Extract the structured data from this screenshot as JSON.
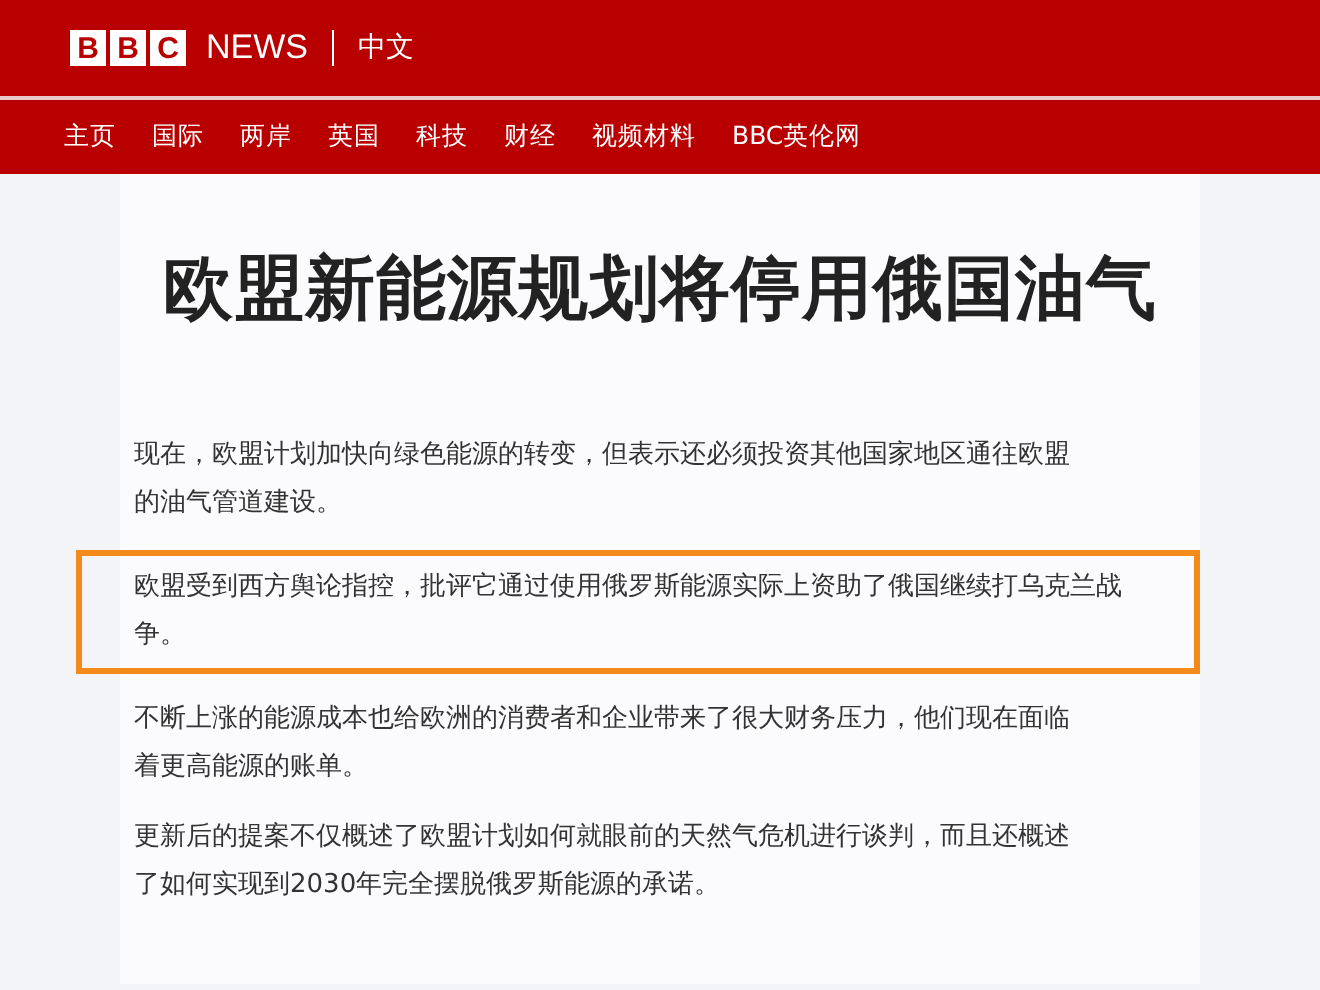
{
  "header": {
    "logo_letters": [
      "B",
      "B",
      "C"
    ],
    "brand": "NEWS",
    "edition": "中文"
  },
  "nav": {
    "items": [
      "主页",
      "国际",
      "两岸",
      "英国",
      "科技",
      "财经",
      "视频材料",
      "BBC英伦网"
    ]
  },
  "article": {
    "headline": "欧盟新能源规划将停用俄国油气",
    "paragraphs": [
      {
        "text": "现在，欧盟计划加快向绿色能源的转变，但表示还必须投资其他国家地区通往欧盟的油气管道建设。",
        "highlighted": false
      },
      {
        "text": "欧盟受到西方舆论指控，批评它通过使用俄罗斯能源实际上资助了俄国继续打乌克兰战争。",
        "highlighted": true
      },
      {
        "text": "不断上涨的能源成本也给欧洲的消费者和企业带来了很大财务压力，他们现在面临着更高能源的账单。",
        "highlighted": false
      },
      {
        "text": "更新后的提案不仅概述了欧盟计划如何就眼前的天然气危机进行谈判，而且还概述了如何实现到2030年完全摆脱俄罗斯能源的承诺。",
        "highlighted": false
      }
    ]
  }
}
